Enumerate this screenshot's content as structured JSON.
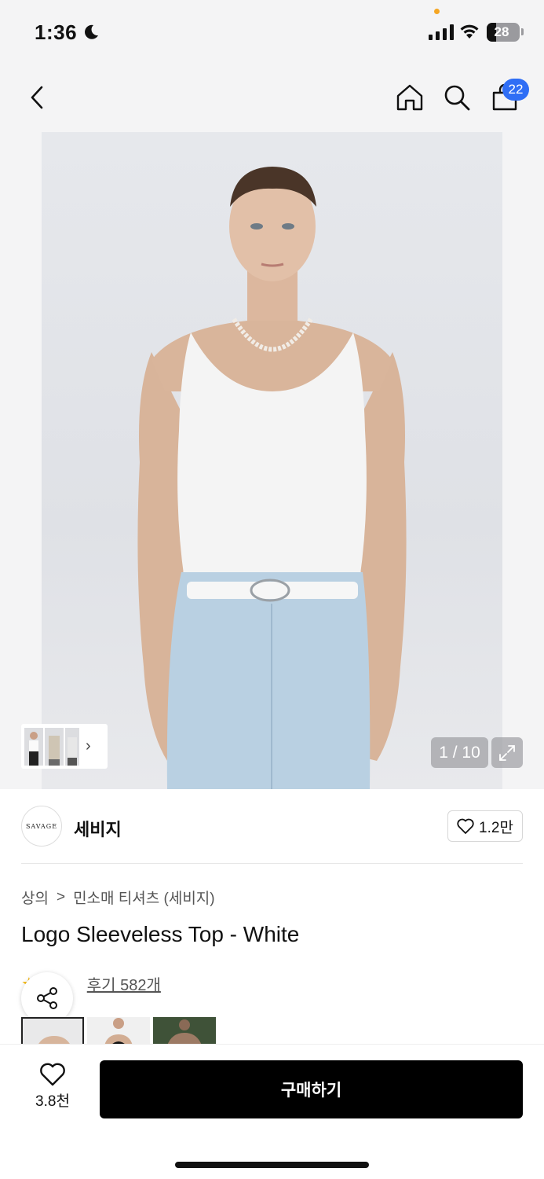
{
  "status_bar": {
    "time": "1:36",
    "battery": "28"
  },
  "nav": {
    "cart_count": "22"
  },
  "hero": {
    "page_counter": "1 / 10"
  },
  "brand": {
    "logo_text": "SAVAGE",
    "name": "세비지",
    "like_count": "1.2만"
  },
  "breadcrumb": {
    "category": "상의",
    "separator": ">",
    "subcategory": "민소매 티셔츠 (세비지)"
  },
  "product": {
    "title": "Logo Sleeveless Top - White",
    "review_link": "후기 582개"
  },
  "bottom_bar": {
    "wish_count": "3.8천",
    "buy_label": "구매하기"
  },
  "colors": {
    "accent": "#2f6ef5",
    "primary_button": "#000000",
    "star": "#f5b400"
  },
  "icons": [
    "moon-icon",
    "signal-icon",
    "wifi-icon",
    "back-icon",
    "home-icon",
    "search-icon",
    "cart-icon",
    "expand-icon",
    "heart-icon",
    "star-icon",
    "share-icon",
    "chevron-right-icon"
  ]
}
